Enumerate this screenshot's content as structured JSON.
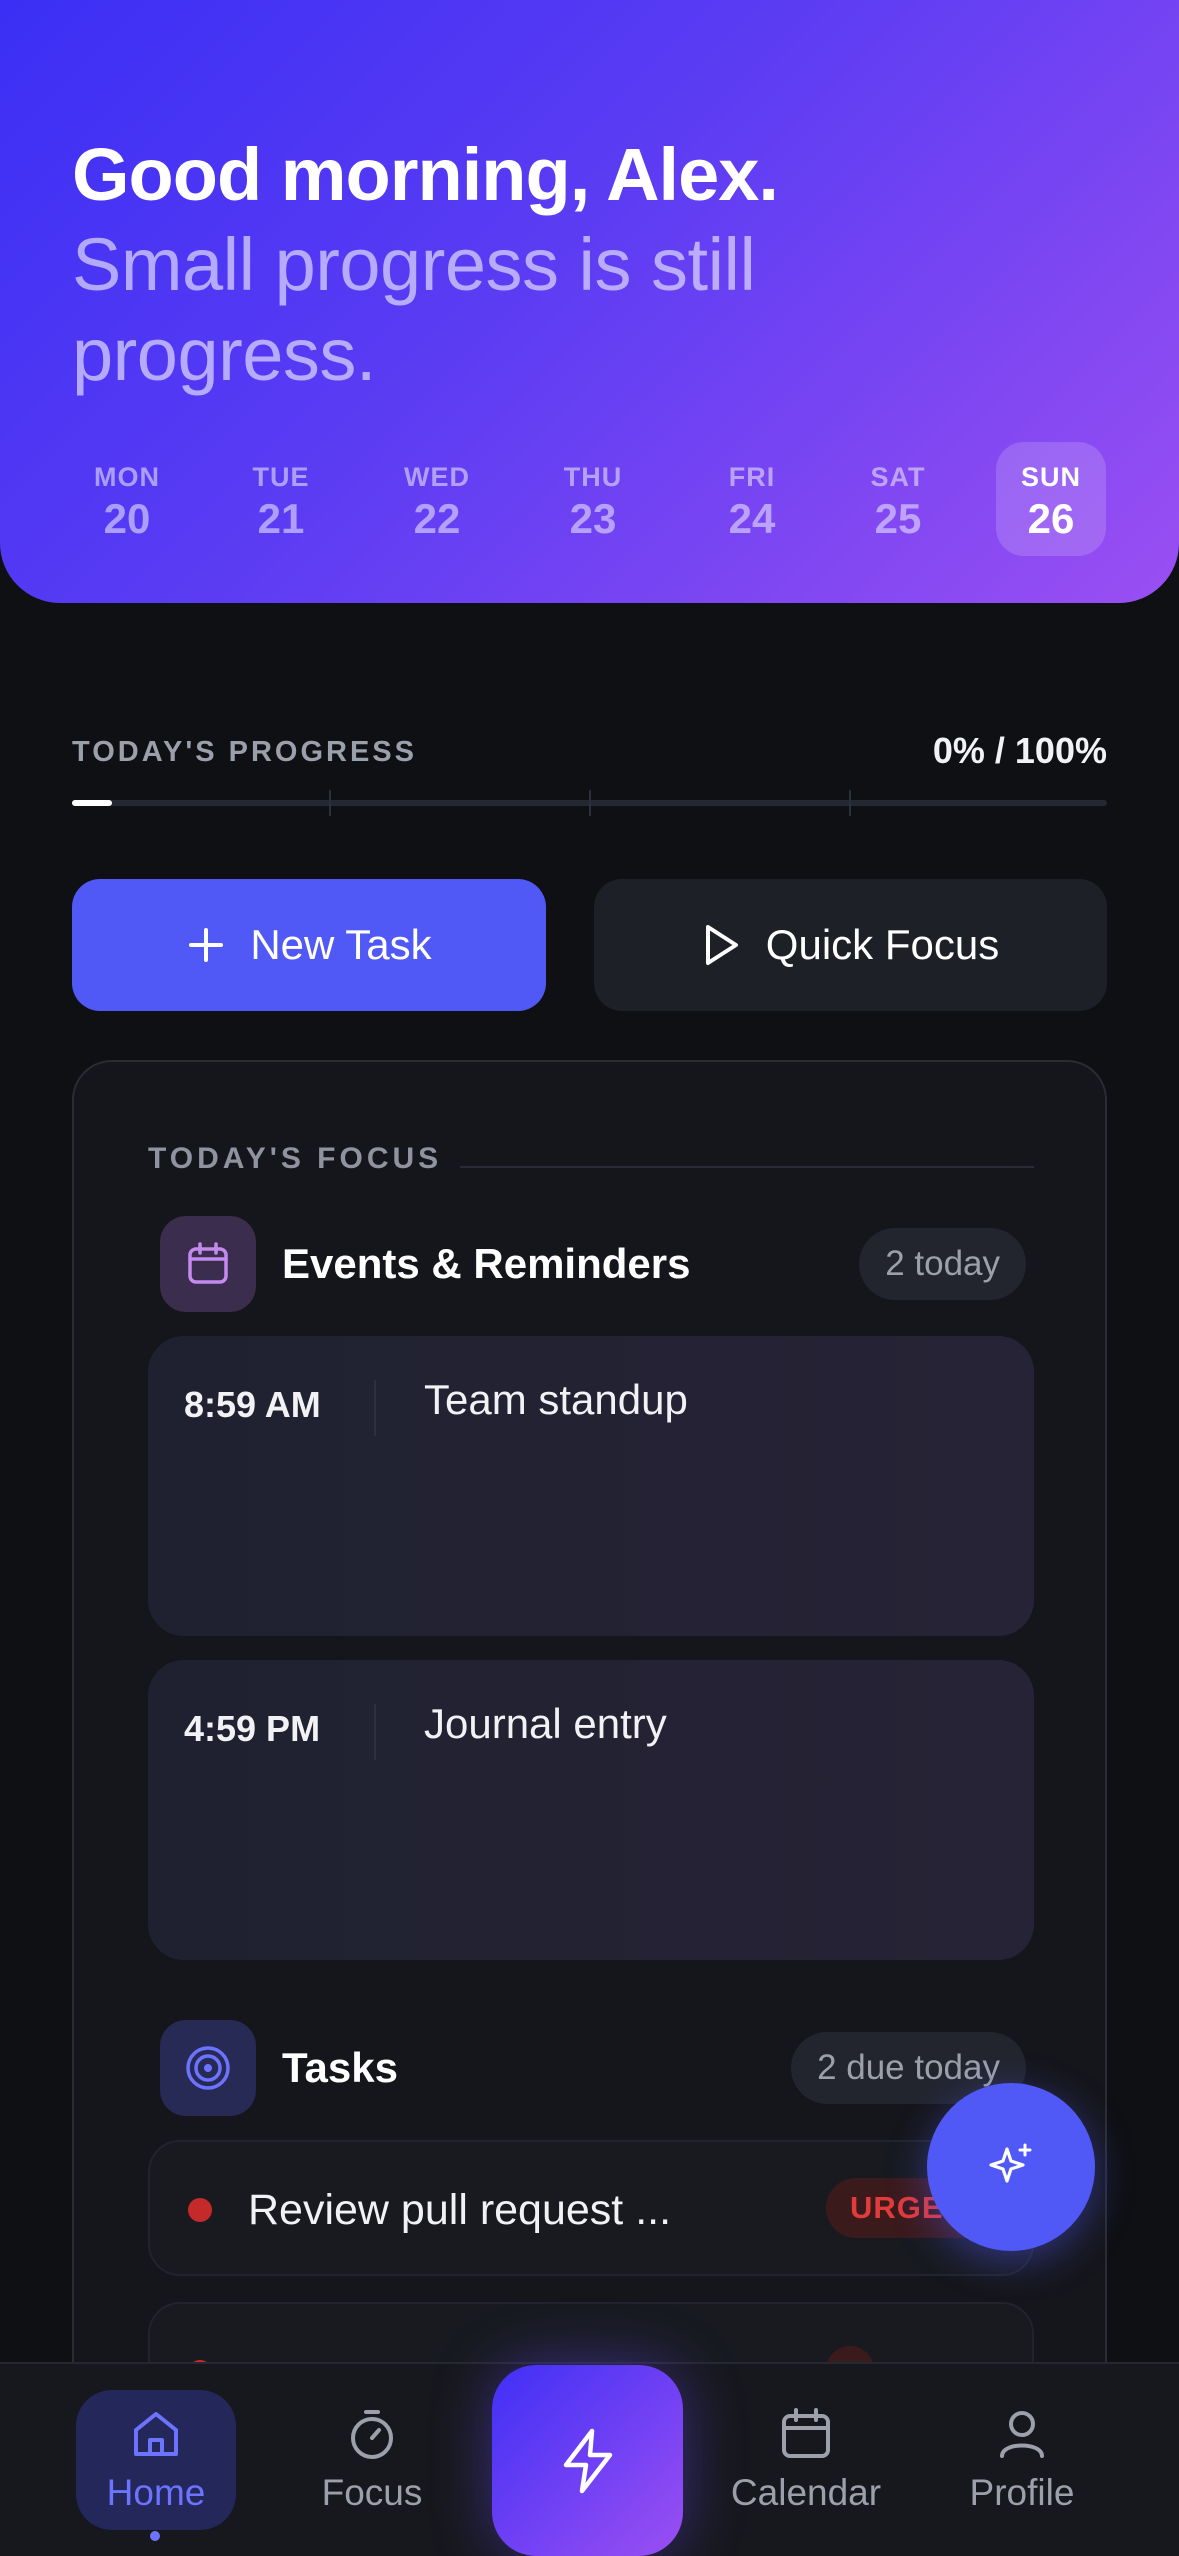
{
  "header": {
    "greeting": "Good morning, Alex.",
    "subtitle": "Small progress is still progress."
  },
  "week": [
    {
      "name": "MON",
      "num": "20"
    },
    {
      "name": "TUE",
      "num": "21"
    },
    {
      "name": "WED",
      "num": "22"
    },
    {
      "name": "THU",
      "num": "23"
    },
    {
      "name": "FRI",
      "num": "24"
    },
    {
      "name": "SAT",
      "num": "25"
    },
    {
      "name": "SUN",
      "num": "26",
      "selected": true
    }
  ],
  "progress": {
    "label": "TODAY'S PROGRESS",
    "value_text": "0% / 100%",
    "fraction": 0
  },
  "actions": {
    "new_task": "New Task",
    "quick_focus": "Quick Focus"
  },
  "focus": {
    "title": "TODAY'S FOCUS",
    "events_section": {
      "title": "Events & Reminders",
      "badge": "2 today",
      "items": [
        {
          "time": "8:59 AM",
          "title": "Team standup"
        },
        {
          "time": "4:59 PM",
          "title": "Journal entry"
        }
      ]
    },
    "tasks_section": {
      "title": "Tasks",
      "badge": "2 due today",
      "items": [
        {
          "title": "Review pull request ...",
          "priority": "URGENT"
        }
      ]
    }
  },
  "colors": {
    "accent": "#5059f5",
    "urgent": "#e23b3b",
    "hero_start": "#3b2ff5",
    "hero_end": "#9a4ff2"
  },
  "tabbar": {
    "home": "Home",
    "focus": "Focus",
    "calendar": "Calendar",
    "profile": "Profile",
    "active": "Home"
  },
  "icons": {
    "fab": "sparkles-icon",
    "center": "lightning-icon",
    "events": "calendar-icon",
    "tasks": "target-icon"
  }
}
